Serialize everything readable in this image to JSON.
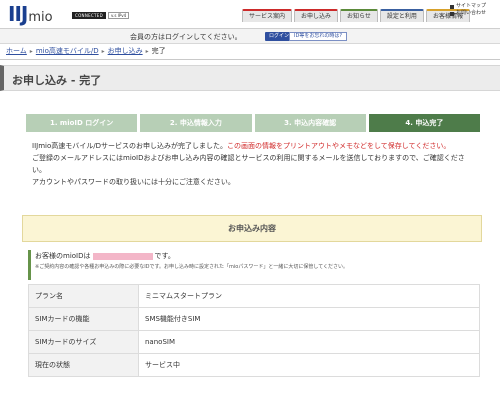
{
  "header": {
    "logo_ij": "IIJ",
    "logo_mio": "mio",
    "connected_label": "CONNECTED",
    "version_label": "v.s IPv4",
    "tabs": [
      {
        "label": "サービス案内"
      },
      {
        "label": "お申し込み"
      },
      {
        "label": "お知らせ"
      },
      {
        "label": "設定と利用"
      },
      {
        "label": "お客様情報"
      }
    ],
    "utility": {
      "sitemap": "サイトマップ",
      "contact": "お問い合わせ"
    }
  },
  "loginbar": {
    "message": "会員の方はログインしてください。",
    "login_button": "ログイン",
    "forgot_button": "ID等をお忘れの時は?"
  },
  "breadcrumb": {
    "items": [
      {
        "label": "ホーム"
      },
      {
        "label": "mio高速モバイル/D"
      },
      {
        "label": "お申し込み"
      },
      {
        "label": "完了"
      }
    ]
  },
  "page": {
    "title": "お申し込み - 完了"
  },
  "steps": [
    {
      "label": "1. mioID ログイン"
    },
    {
      "label": "2. 申込情報入力"
    },
    {
      "label": "3. 申込内容確認"
    },
    {
      "label": "4. 申込完了"
    }
  ],
  "body": {
    "line1_a": "IIJmio高速モバイル/Dサービスのお申し込みが完了しました。",
    "line1_b": "この画面の情報をプリントアウトやメモなどをして保存してください。",
    "line2": "ご登録のメールアドレスにはmioIDおよびお申し込み内容の確認とサービスの利用に関するメールを送信しておりますので、ご確認ください。",
    "line3": "アカウントやパスワードの取り扱いには十分にご注意ください。"
  },
  "section": {
    "title": "お申込み内容"
  },
  "idrow": {
    "prefix": "お客様のmioIDは",
    "suffix": "です。",
    "note": "※ご契約内容の確認や各種お申込みの際に必要なIDです。お申し込み時に設定された「mioパスワード」と一緒に大切に保管してください。"
  },
  "table": {
    "rows": [
      {
        "key": "プラン名",
        "value": "ミニマムスタートプラン"
      },
      {
        "key": "SIMカードの機能",
        "value": "SMS機能付きSIM"
      },
      {
        "key": "SIMカードのサイズ",
        "value": "nanoSIM"
      },
      {
        "key": "現在の状態",
        "value": "サービス中"
      }
    ]
  },
  "colors": {
    "brand_blue": "#1a3f8f",
    "step_active": "#4e7c4a",
    "step_inactive": "#b7cfb6",
    "warning_red": "#d12a2a",
    "section_bg": "#fbf5d4",
    "masked_id": "#f3b6c8"
  }
}
